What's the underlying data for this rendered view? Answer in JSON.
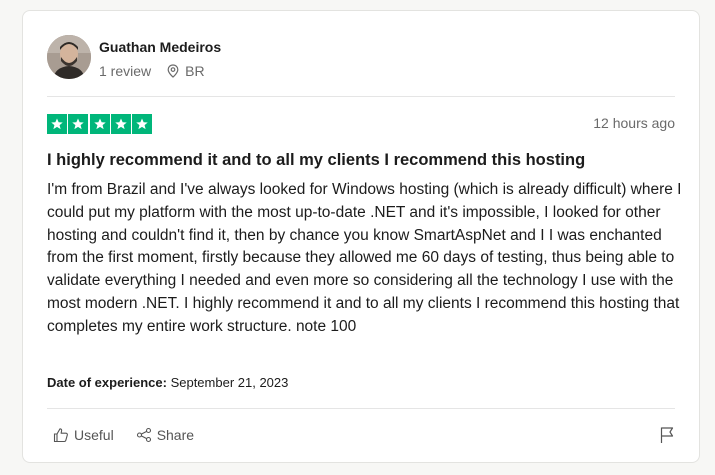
{
  "reviewer": {
    "name": "Guathan Medeiros",
    "review_count": "1 review",
    "country": "BR",
    "avatar_icon": "user-photo"
  },
  "review": {
    "rating": 5,
    "rating_max": 5,
    "star_color": "#00b67a",
    "posted": "12 hours ago",
    "title": "I highly recommend it and to all my clients I recommend this hosting",
    "body": "I'm from Brazil and I've always looked for Windows hosting (which is already difficult) where I could put my platform with the most up-to-date .NET and it's impossible, I looked for other hosting and couldn't find it, then by chance you know SmartAspNet and I I was enchanted from the first moment, firstly because they allowed me 60 days of testing, thus being able to validate everything I needed and even more so considering all the technology I use with the most modern .NET. I highly recommend it and to all my clients I recommend this hosting that completes my entire work structure. note 100",
    "experience_label": "Date of experience:",
    "experience_date": "September 21, 2023"
  },
  "actions": {
    "useful_label": "Useful",
    "share_label": "Share",
    "useful_icon": "thumbs-up-icon",
    "share_icon": "share-icon",
    "flag_icon": "flag-icon"
  }
}
